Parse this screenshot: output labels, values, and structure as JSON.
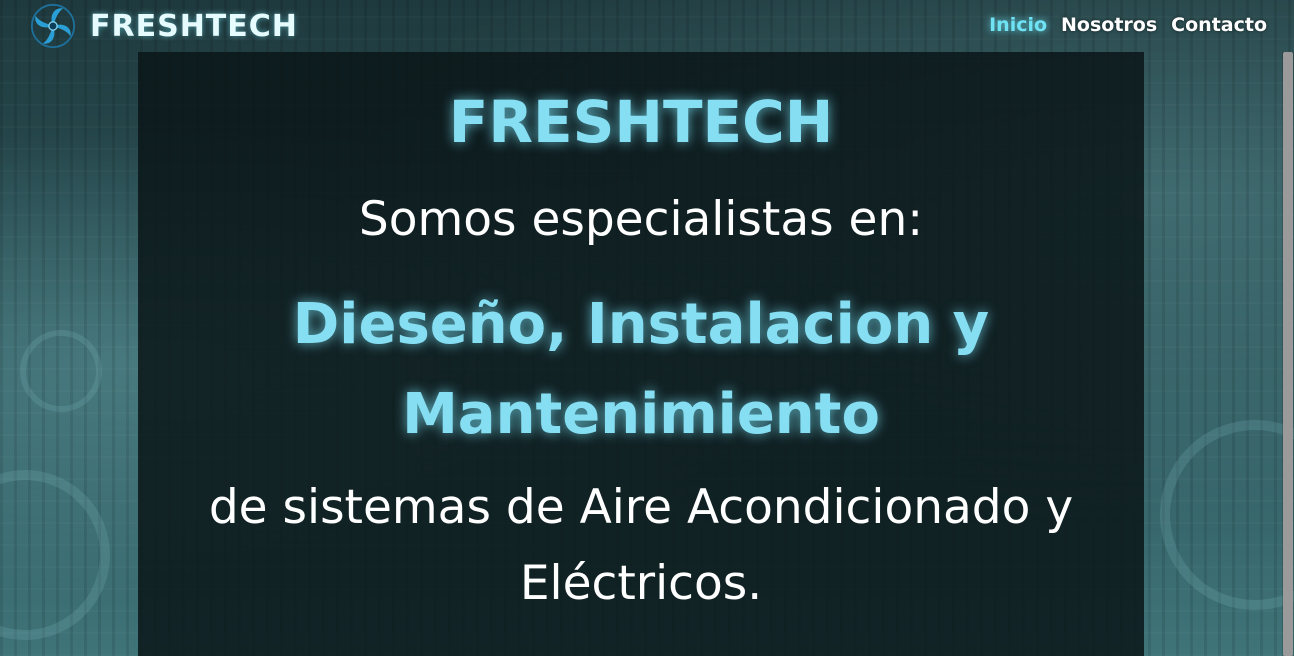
{
  "header": {
    "brand_name": "FRESHTECH",
    "logo_icon": "fan-logo-icon",
    "nav": [
      {
        "label": "Inicio",
        "active": true
      },
      {
        "label": "Nosotros",
        "active": false
      },
      {
        "label": "Contacto",
        "active": false
      }
    ]
  },
  "hero": {
    "title": "FRESHTECH",
    "subtitle": "Somos especialistas en:",
    "highlight_line1": "Dieseño, Instalacion y",
    "highlight_line2": "Mantenimiento",
    "description_line1": "de sistemas de Aire Acondicionado y",
    "description_line2": "Eléctricos."
  },
  "colors": {
    "accent": "#86def2",
    "nav_active": "#6fe3f4",
    "panel_bg": "#0a1618",
    "background": "#2b5257"
  }
}
